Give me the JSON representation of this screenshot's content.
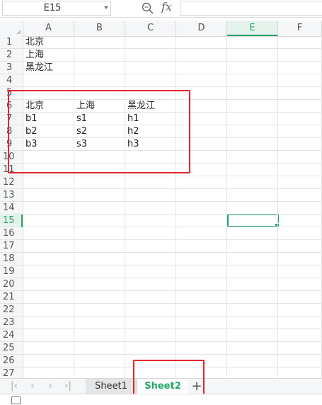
{
  "formula_bar": {
    "cell_reference": "E15",
    "fx_label": "fx",
    "formula_value": ""
  },
  "columns": [
    "A",
    "B",
    "C",
    "D",
    "E",
    "F"
  ],
  "active_column": "E",
  "rows": [
    "1",
    "2",
    "3",
    "4",
    "5",
    "6",
    "7",
    "8",
    "9",
    "10",
    "11",
    "12",
    "13",
    "14",
    "15",
    "16",
    "17",
    "18",
    "19",
    "20",
    "21",
    "22",
    "23",
    "24",
    "25",
    "26",
    "27"
  ],
  "active_row": "15",
  "cells": {
    "A1": "北京",
    "A2": "上海",
    "A3": "黑龙江",
    "A6": "北京",
    "B6": "上海",
    "C6": "黑龙江",
    "A7": "b1",
    "B7": "s1",
    "C7": "h1",
    "A8": "b2",
    "B8": "s2",
    "C8": "h2",
    "A9": "b3",
    "B9": "s3",
    "C9": "h3"
  },
  "sheet_tabs": [
    {
      "label": "Sheet1",
      "active": false
    },
    {
      "label": "Sheet2",
      "active": true
    }
  ],
  "colors": {
    "accent": "#22a567",
    "annotation": "#e3262f"
  }
}
